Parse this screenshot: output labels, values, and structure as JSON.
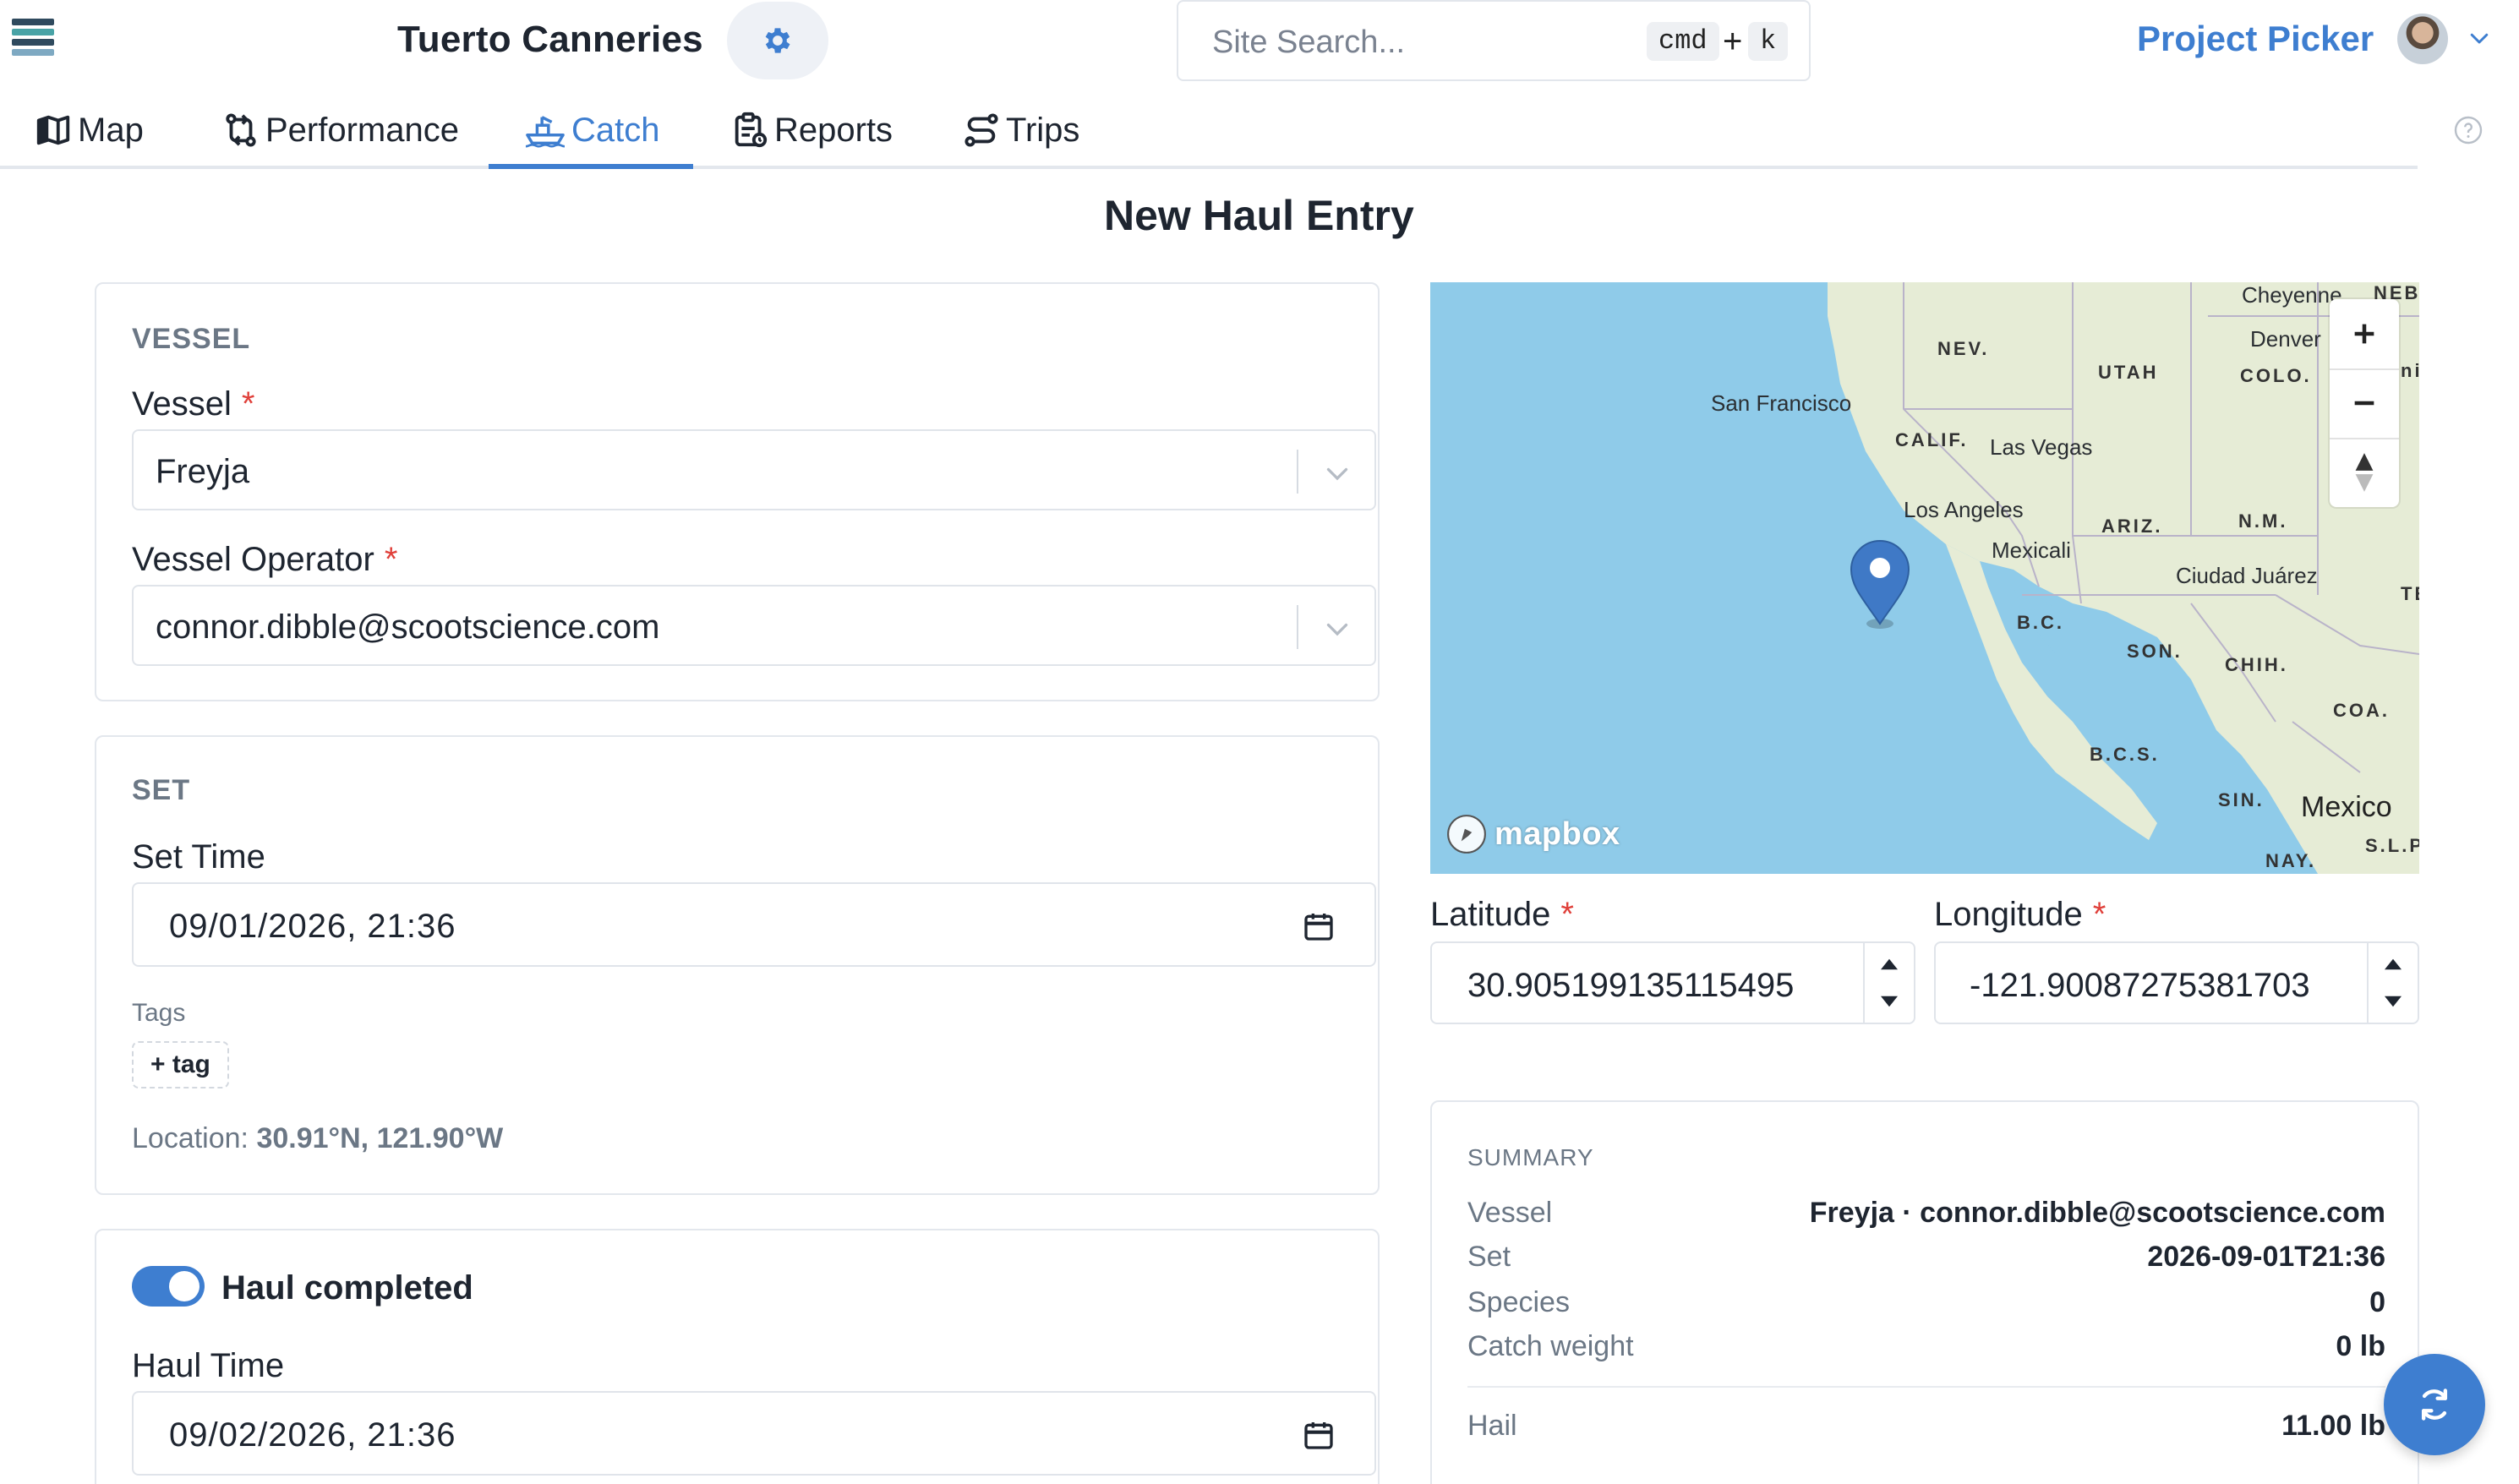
{
  "header": {
    "brand_title": "Tuerto Canneries",
    "search_placeholder": "Site Search...",
    "shortcut_key1": "cmd",
    "shortcut_plus": "+",
    "shortcut_key2": "k",
    "project_picker": "Project Picker"
  },
  "tabs": [
    {
      "label": "Map",
      "icon": "map-icon"
    },
    {
      "label": "Performance",
      "icon": "performance-icon"
    },
    {
      "label": "Catch",
      "icon": "boat-icon",
      "active": true
    },
    {
      "label": "Reports",
      "icon": "clipboard-icon"
    },
    {
      "label": "Trips",
      "icon": "route-icon"
    }
  ],
  "page": {
    "title": "New Haul Entry"
  },
  "vessel_section": {
    "title": "VESSEL",
    "vessel_label": "Vessel",
    "vessel_value": "Freyja",
    "operator_label": "Vessel Operator",
    "operator_value": "connor.dibble@scootscience.com",
    "required_mark": "*"
  },
  "set_section": {
    "title": "SET",
    "set_time_label": "Set Time",
    "set_time_value": "09/01/2026, 21:36",
    "tags_label": "Tags",
    "add_tag_label": "+ tag",
    "location_prefix": "Location:",
    "location_value": "30.91°N, 121.90°W"
  },
  "haul_section": {
    "toggle_label": "Haul completed",
    "toggle_on": true,
    "haul_time_label": "Haul Time",
    "haul_time_value": "09/02/2026, 21:36"
  },
  "map": {
    "labels": {
      "cheyenne": "Cheyenne",
      "neb": "NEB",
      "denver": "Denver",
      "nev": "NEV.",
      "utah": "UTAH",
      "colo": "COLO.",
      "san_francisco": "San Francisco",
      "calif": "CALIF.",
      "las_vegas": "Las Vegas",
      "los_angeles": "Los Angeles",
      "ariz": "ARIZ.",
      "nm": "N.M.",
      "mexicali": "Mexicali",
      "ciudad_juarez": "Ciudad Juárez",
      "te": "TE",
      "bc": "B.C.",
      "son": "SON.",
      "chih": "CHIH.",
      "coa": "COA.",
      "bcs": "B.C.S.",
      "sin": "SIN.",
      "mexico": "Mexico",
      "slp": "S.L.P",
      "nay": "NAY.",
      "partial": "ni"
    },
    "attribution": "mapbox",
    "water_color": "#8fcbe9",
    "land_color": "#e6ecd6",
    "pin_color": "#3f79c6"
  },
  "coordinates": {
    "latitude_label": "Latitude",
    "latitude_value": "30.905199135115495",
    "longitude_label": "Longitude",
    "longitude_value": "-121.90087275381703",
    "required_mark": "*"
  },
  "summary": {
    "title": "SUMMARY",
    "rows": [
      {
        "key": "Vessel",
        "value": "Freyja · connor.dibble@scootscience.com"
      },
      {
        "key": "Set",
        "value": "2026-09-01T21:36"
      },
      {
        "key": "Species",
        "value": "0"
      },
      {
        "key": "Catch weight",
        "value": "0 lb"
      },
      {
        "key": "Hail",
        "value": "11.00 lb"
      }
    ]
  },
  "colors": {
    "accent": "#3e7ed0",
    "required": "#e0403a",
    "muted_text": "#6b7785"
  }
}
